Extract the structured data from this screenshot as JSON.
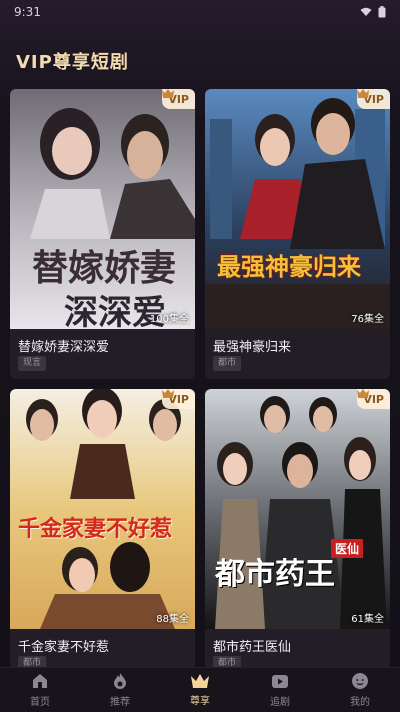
{
  "status_bar": {
    "time": "9:31"
  },
  "page": {
    "title": "VIP尊享短剧"
  },
  "cards": [
    {
      "title": "替嫁娇妻深深爱",
      "tag": "现言",
      "episodes": "100集全",
      "vip": "VIP",
      "poster_text_1": "替嫁娇妻",
      "poster_text_2": "深深爱"
    },
    {
      "title": "最强神豪归来",
      "tag": "都市",
      "episodes": "76集全",
      "vip": "VIP",
      "poster_text_1": "最强神豪归来",
      "poster_text_2": ""
    },
    {
      "title": "千金家妻不好惹",
      "tag": "都市",
      "episodes": "88集全",
      "vip": "VIP",
      "poster_text_1": "千金家妻不好惹",
      "poster_text_2": ""
    },
    {
      "title": "都市药王医仙",
      "tag": "都市",
      "episodes": "61集全",
      "vip": "VIP",
      "poster_text_1": "都市药王",
      "poster_text_2": "医仙"
    }
  ],
  "tabs": [
    {
      "label": "首页",
      "icon": "home-icon"
    },
    {
      "label": "推荐",
      "icon": "flame-icon"
    },
    {
      "label": "尊享",
      "icon": "crown-icon",
      "active": true
    },
    {
      "label": "追剧",
      "icon": "play-tv-icon"
    },
    {
      "label": "我的",
      "icon": "profile-icon"
    }
  ],
  "colors": {
    "accent": "#f3d39a",
    "background": "#141018",
    "card": "#221d27"
  }
}
